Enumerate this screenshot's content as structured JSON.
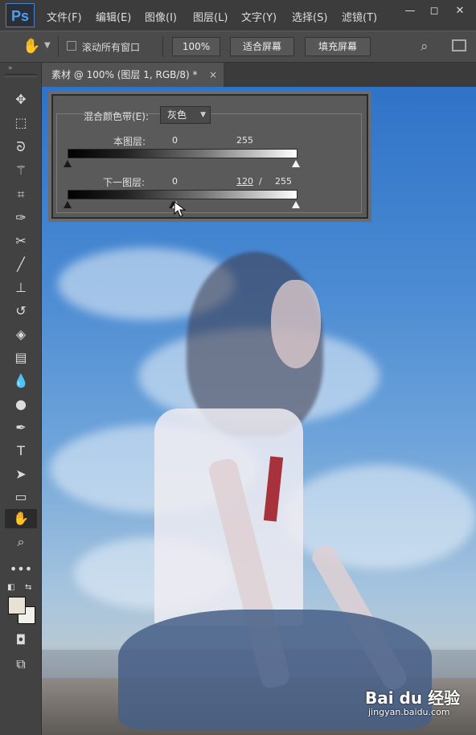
{
  "app": {
    "logo": "Ps"
  },
  "menu": {
    "items": [
      "文件(F)",
      "编辑(E)",
      "图像(I)",
      "图层(L)",
      "文字(Y)",
      "选择(S)",
      "滤镜(T)"
    ],
    "window_controls": {
      "minimize": "—",
      "restore": "◻",
      "close": "✕"
    }
  },
  "options": {
    "tool_icon": "hand-icon",
    "scroll_all_label": "滚动所有窗口",
    "scroll_all_checked": false,
    "zoom_value": "100%",
    "fit_screen_label": "适合屏幕",
    "fill_screen_label": "填充屏幕"
  },
  "document_tab": {
    "title": "素材 @ 100% (图层 1, RGB/8) *",
    "close": "×"
  },
  "tools": [
    "move-icon",
    "marquee-icon",
    "lasso-icon",
    "magic-wand-icon",
    "crop-icon",
    "eyedropper-icon",
    "healing-icon",
    "brush-icon",
    "stamp-icon",
    "history-brush-icon",
    "eraser-icon",
    "gradient-icon",
    "blur-icon",
    "dodge-icon",
    "pen-icon",
    "type-icon",
    "path-select-icon",
    "rectangle-icon",
    "hand-icon",
    "zoom-icon"
  ],
  "colors": {
    "foreground": "#e8e2d4",
    "background": "#f2f0ea"
  },
  "blend_if": {
    "label": "混合颜色带(E):",
    "channel": "灰色",
    "this_layer": {
      "label": "本图层:",
      "black": "0",
      "white": "255"
    },
    "underlying_layer": {
      "label": "下一图层:",
      "black": "0",
      "split_low": "120",
      "slash": "/",
      "white": "255"
    }
  },
  "watermark": {
    "brand": "Bai du 经验",
    "url": "jingyan.baidu.com"
  }
}
